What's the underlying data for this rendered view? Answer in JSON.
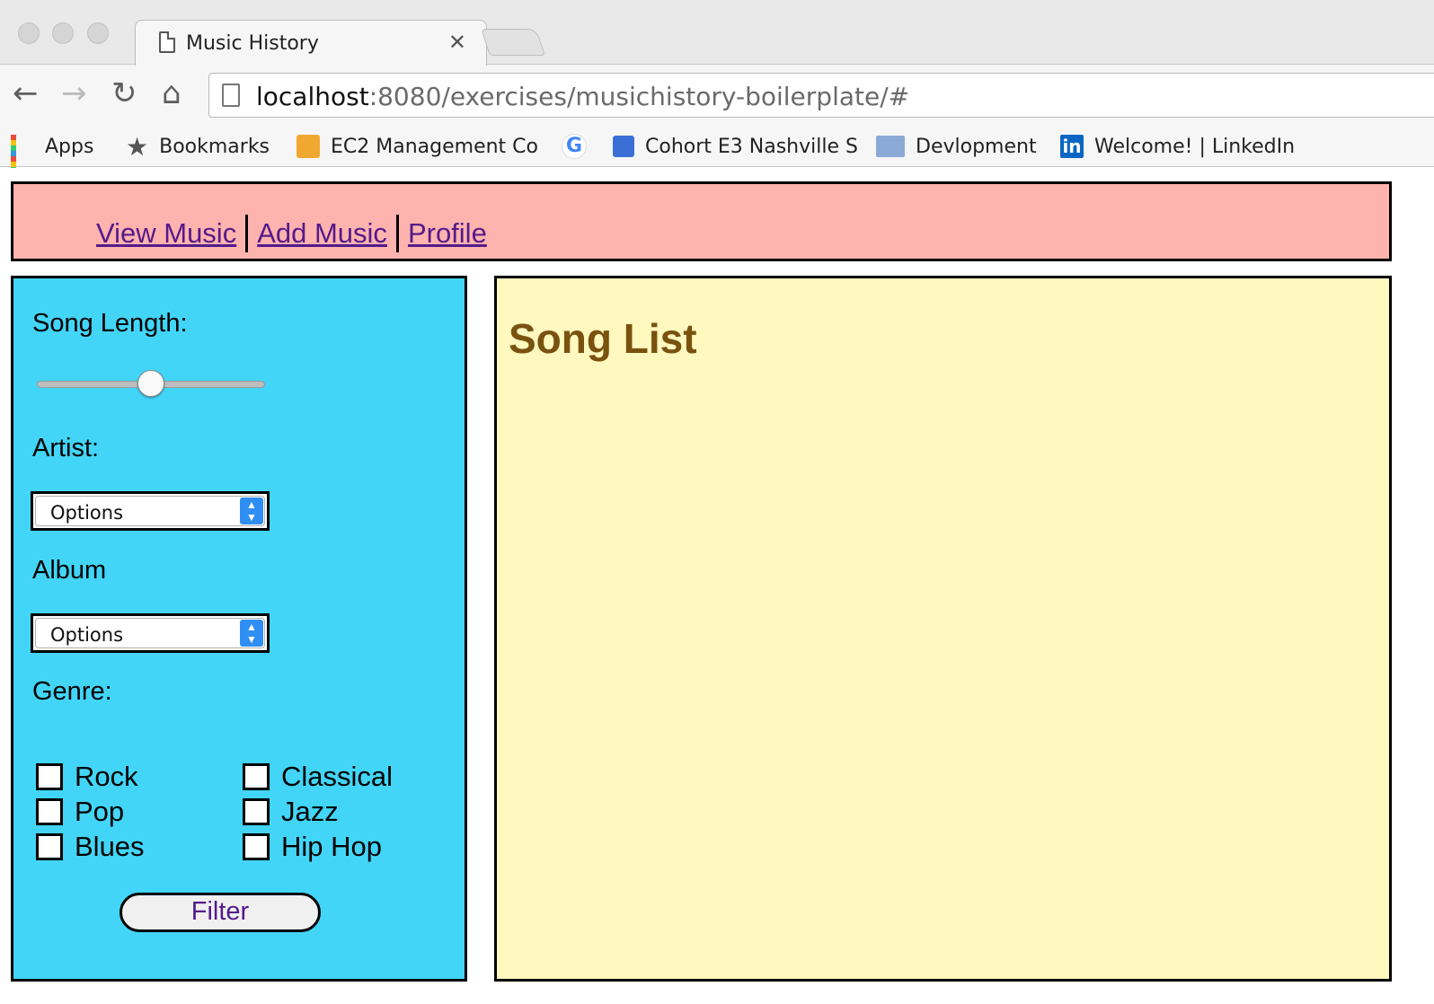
{
  "browser": {
    "tab_title": "Music History",
    "tab_close": "✕",
    "url_host": "localhost",
    "url_rest": ":8080/exercises/musichistory-boilerplate/#",
    "nav": {
      "back": "←",
      "forward": "→",
      "reload": "↻",
      "home": "⌂"
    },
    "bookmarks": [
      {
        "label": "Apps",
        "icon": "apps-grid-icon"
      },
      {
        "label": "Bookmarks",
        "icon": "star-icon"
      },
      {
        "label": "EC2 Management Co",
        "icon": "aws-box-icon"
      },
      {
        "label": "G",
        "icon": "google-icon"
      },
      {
        "label": "Cohort E3 Nashville S",
        "icon": "classroom-icon"
      },
      {
        "label": "Devlopment",
        "icon": "folder-icon"
      },
      {
        "label": "Welcome! | LinkedIn",
        "icon": "linkedin-icon"
      }
    ]
  },
  "topnav": {
    "links": [
      "View Music",
      "Add Music",
      "Profile"
    ]
  },
  "sidebar": {
    "song_length_label": "Song Length:",
    "song_length_value": 0.5,
    "artist_label": "Artist:",
    "artist_select": "Options",
    "album_label": "Album",
    "album_select": "Options",
    "genre_label": "Genre:",
    "genres": [
      "Rock",
      "Classical",
      "Pop",
      "Jazz",
      "Blues",
      "Hip Hop"
    ],
    "filter_label": "Filter"
  },
  "main": {
    "title": "Song List"
  },
  "colors": {
    "nav_bg": "#ffb3ae",
    "sidebar_bg": "#42d5f7",
    "main_bg": "#fff8bf",
    "title_color": "#7a520f",
    "link_color": "#551a8b"
  }
}
